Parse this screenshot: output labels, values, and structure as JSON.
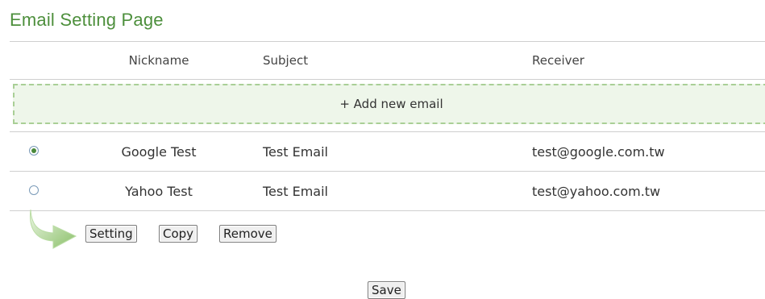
{
  "page": {
    "title": "Email Setting Page"
  },
  "table": {
    "headers": {
      "nickname": "Nickname",
      "subject": "Subject",
      "receiver": "Receiver"
    },
    "add_label": "+ Add new email",
    "rows": [
      {
        "nickname": "Google Test",
        "subject": "Test Email",
        "receiver": "test@google.com.tw",
        "selected": true
      },
      {
        "nickname": "Yahoo Test",
        "subject": "Test Email",
        "receiver": "test@yahoo.com.tw",
        "selected": false
      }
    ]
  },
  "actions": {
    "setting_label": "Setting",
    "copy_label": "Copy",
    "remove_label": "Remove"
  },
  "footer": {
    "save_label": "Save"
  },
  "colors": {
    "accent": "#4d8f3c",
    "add_bg": "#eef6ea",
    "add_border": "#a9cf96"
  },
  "icons": {
    "arrow": "curved-arrow-icon"
  }
}
